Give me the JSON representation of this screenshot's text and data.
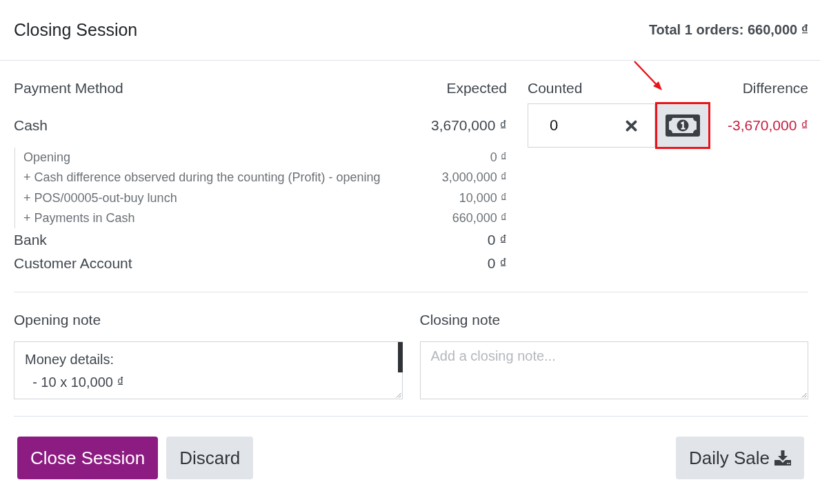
{
  "dialog": {
    "title": "Closing Session",
    "total": "Total 1 orders: 660,000 ₫"
  },
  "payments": {
    "columns": [
      "Payment Method",
      "Expected",
      "Counted",
      "Difference"
    ],
    "rows": [
      {
        "kind": "cash",
        "name": "Cash",
        "expected": "3,670,000 ₫",
        "counted": "0",
        "count_button": {
          "highlighted": true
        },
        "difference": "-3,670,000 ₫",
        "difference_negative": true,
        "details": [
          {
            "label": "Opening",
            "amount": "0 ₫"
          },
          {
            "label": "+ Cash difference observed during the counting (Profit) - opening",
            "amount": "3,000,000 ₫"
          },
          {
            "label": "+ POS/00005-out-buy lunch",
            "amount": "10,000 ₫"
          },
          {
            "label": "+ Payments in Cash",
            "amount": "660,000 ₫"
          }
        ]
      },
      {
        "kind": "plain",
        "name": "Bank",
        "expected": "0 ₫"
      },
      {
        "kind": "plain",
        "name": "Customer Account",
        "expected": "0 ₫"
      }
    ]
  },
  "notes": [
    {
      "label": "Opening note",
      "value": "Money details:\n  - 10 x 10,000 ₫"
    },
    {
      "label": "Closing note",
      "placeholder": "Add a closing note..."
    }
  ],
  "buttons": [
    {
      "label": "Close Session",
      "kind": "primary"
    },
    {
      "label": "Discard",
      "kind": "secondary"
    },
    {
      "label": "Daily Sale",
      "kind": "download"
    }
  ]
}
